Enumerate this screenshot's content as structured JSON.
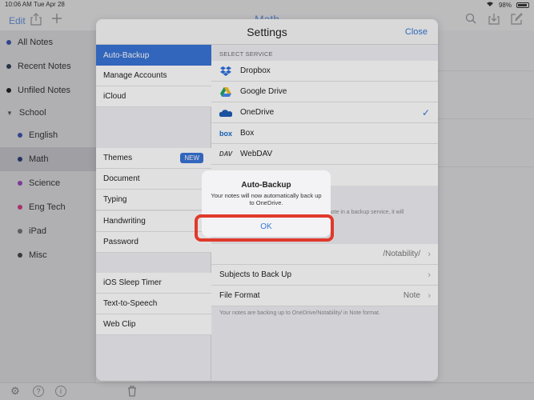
{
  "status": {
    "time": "10:06 AM",
    "date": "Tue Apr 28",
    "battery": "98%"
  },
  "topbar": {
    "edit": "Edit",
    "title": "Math"
  },
  "sidebar": {
    "items": [
      {
        "label": "All Notes",
        "color": "#3b4fa0"
      },
      {
        "label": "Recent Notes",
        "color": "#2c3e50"
      },
      {
        "label": "Unfiled Notes",
        "color": "#222222"
      },
      {
        "label": "School",
        "color": ""
      },
      {
        "label": "English",
        "color": "#3b4fa0"
      },
      {
        "label": "Math",
        "color": "#2c3a6e"
      },
      {
        "label": "Science",
        "color": "#8e44ad"
      },
      {
        "label": "Eng Tech",
        "color": "#c0397d"
      },
      {
        "label": "iPad",
        "color": "#6b6b6b"
      },
      {
        "label": "Misc",
        "color": "#444444"
      }
    ]
  },
  "settings": {
    "title": "Settings",
    "close": "Close",
    "left_items": {
      "auto_backup": "Auto-Backup",
      "manage_accounts": "Manage Accounts",
      "icloud": "iCloud",
      "themes": "Themes",
      "new_badge": "NEW",
      "document": "Document",
      "typing": "Typing",
      "handwriting": "Handwriting",
      "password": "Password",
      "ios_sleep_timer": "iOS Sleep Timer",
      "text_to_speech": "Text-to-Speech",
      "web_clip": "Web Clip"
    },
    "select_service_label": "SELECT SERVICE",
    "services": [
      {
        "label": "Dropbox",
        "icon": "dropbox-icon"
      },
      {
        "label": "Google Drive",
        "icon": "google-drive-icon"
      },
      {
        "label": "OneDrive",
        "icon": "onedrive-icon",
        "selected": true
      },
      {
        "label": "Box",
        "icon": "box-icon"
      },
      {
        "label": "WebDAV",
        "icon": "webdav-icon"
      }
    ],
    "partial_text": "a note in a backup service, it will",
    "folder_value": "/Notability/",
    "subjects_to_backup": "Subjects to Back Up",
    "file_format": "File Format",
    "file_format_value": "Note",
    "footnote": "Your notes are backing up to OneDrive/Notability/ in Note format."
  },
  "alert": {
    "title": "Auto-Backup",
    "message": "Your notes will now automatically back up to OneDrive.",
    "ok": "OK"
  },
  "colors": {
    "accent": "#3478d6",
    "highlight": "#e0392b"
  }
}
